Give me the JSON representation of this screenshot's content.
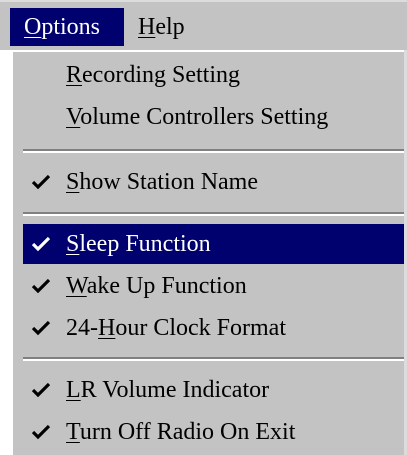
{
  "menubar": {
    "options": {
      "pre": "",
      "key": "O",
      "post": "ptions"
    },
    "help": {
      "pre": "",
      "key": "H",
      "post": "elp"
    }
  },
  "menu": {
    "items": [
      {
        "pre": "",
        "key": "R",
        "post": "ecording Setting",
        "checked": false
      },
      {
        "pre": "",
        "key": "V",
        "post": "olume Controllers Setting",
        "checked": false
      },
      {
        "pre": "",
        "key": "S",
        "post": "how Station Name",
        "checked": true
      },
      {
        "pre": "",
        "key": "S",
        "post": "leep Function",
        "checked": true,
        "highlighted": true
      },
      {
        "pre": "",
        "key": "W",
        "post": "ake Up Function",
        "checked": true
      },
      {
        "pre": "24-",
        "key": "H",
        "post": "our Clock Format",
        "checked": true
      },
      {
        "pre": "",
        "key": "L",
        "post": "R Volume Indicator",
        "checked": true
      },
      {
        "pre": "",
        "key": "T",
        "post": "urn Off Radio On Exit",
        "checked": true
      }
    ]
  },
  "colors": {
    "menu_bg": "#c3c3c3",
    "highlight_bg": "#00006e",
    "highlight_fg": "#ffffff"
  },
  "icons": {
    "check": "check-icon"
  }
}
